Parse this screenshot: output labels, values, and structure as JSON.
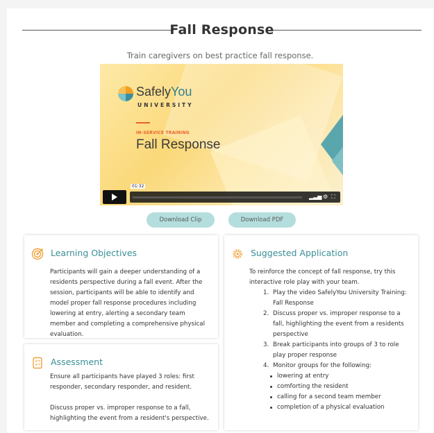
{
  "page": {
    "title": "Fall Response",
    "subtitle": "Train caregivers on best practice fall response."
  },
  "video": {
    "brand_name_part1": "Safely",
    "brand_name_part2": "You",
    "brand_subline": "UNIVERSITY",
    "kicker": "IN-SERVICE TRAINING",
    "title": "Fall Response",
    "time": "01:32",
    "progress": 0
  },
  "buttons": {
    "download_clip": "Download Clip",
    "download_pdf": "Download PDF"
  },
  "learning_objectives": {
    "title": "Learning Objectives",
    "body": "Participants will gain a deeper understanding of a residents perspective during a fall event. After the session, participants will be able to identify and model proper fall response procedures including lowering at entry, alerting a secondary team member and completing a comprehensive physical evaluation."
  },
  "assessment": {
    "title": "Assessment",
    "para1": "Ensure all participants have played 3 roles: first responder, secondary responder, and resident.",
    "para2": "Discuss proper vs. improper response to a fall, highlighting the event from a resident's perspective."
  },
  "suggested_application": {
    "title": "Suggested Application",
    "intro": "To reinforce the concept of fall response, try this interactive role play with your team.",
    "steps": [
      "Play the video SafelyYou University Training: Fall Response",
      "Discuss proper vs. improper response to a fall, highlighting the event from a residents perspective",
      "Break participants into groups of 3 to role play proper response",
      "Monitor groups for the following:"
    ],
    "step_numbers": [
      "1.",
      "2.",
      "3.",
      "4."
    ],
    "monitor_items": [
      "lowering at entry",
      "comforting the resident",
      "calling for a second team member",
      "completion of a physical evaluation"
    ]
  },
  "colors": {
    "accent_teal": "#3a8f97",
    "icon_orange": "#f0a23a",
    "button_bg": "#b4dede"
  }
}
